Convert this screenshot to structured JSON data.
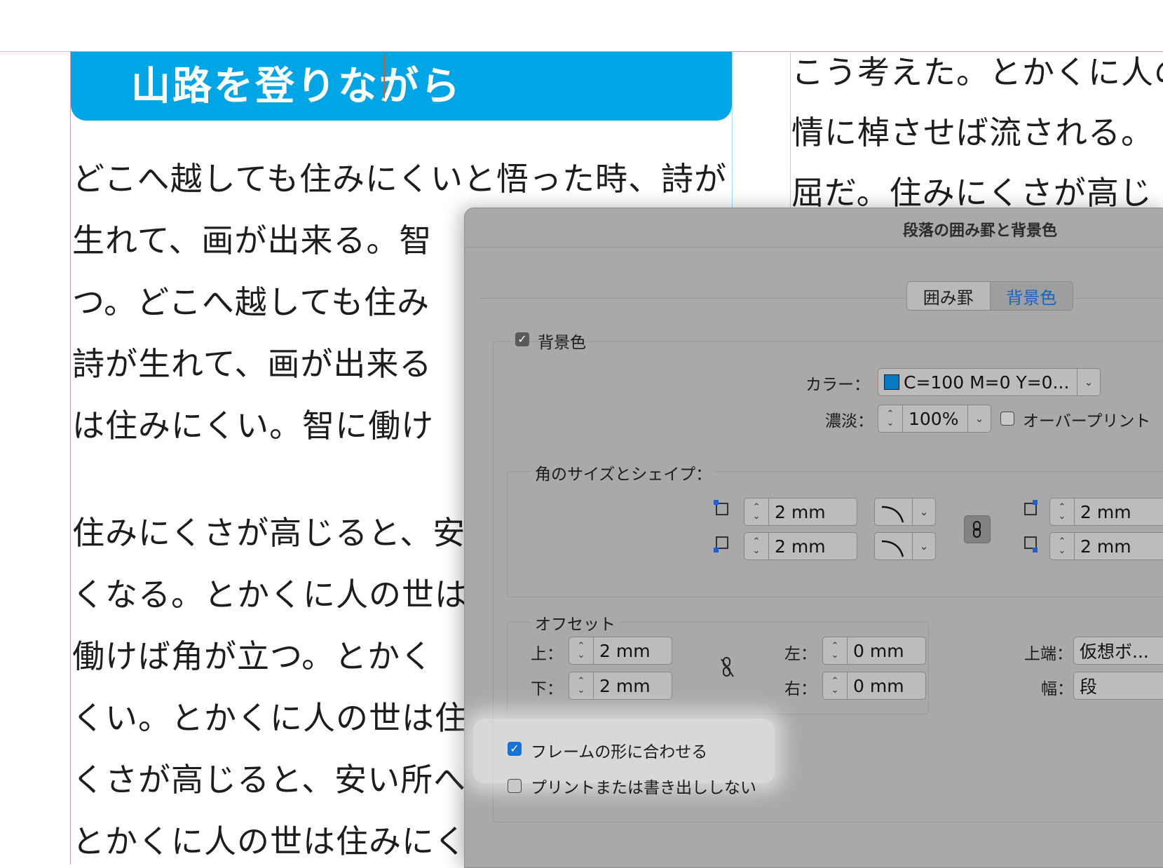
{
  "document": {
    "heading": "山路を登りながら",
    "col1_lines": [
      "どこへ越しても住みにくいと悟った時、詩が",
      "生れて、画が出来る。智",
      "つ。どこへ越しても住み",
      "詩が生れて、画が出来る",
      "は住みにくい。智に働け",
      "住みにくさが高じると、安",
      "くなる。とかくに人の世は",
      "働けば角が立つ。とかく",
      "くい。とかくに人の世は住",
      "くさが高じると、安い所へ",
      "とかくに人の世は住みにく"
    ],
    "col2_lines": [
      "こう考えた。とかくに人の",
      "情に棹させば流される。",
      "屈だ。住みにくさが高じ"
    ]
  },
  "dialog": {
    "title": "段落の囲み罫と背景色",
    "tabs": [
      {
        "label": "囲み罫"
      },
      {
        "label": "背景色"
      }
    ],
    "background_checkbox": "背景色",
    "color_label": "カラー：",
    "color_value": "C=100 M=0 Y=0...",
    "color_swatch": "#0a79c3",
    "tint_label": "濃淡：",
    "tint_value": "100%",
    "overprint_label": "オーバープリント",
    "corner_section": "角のサイズとシェイプ：",
    "corner_top_left": "2 mm",
    "corner_bottom_left": "2 mm",
    "corner_top_right": "2 mm",
    "corner_bottom_right": "2 mm",
    "offset_section": "オフセット",
    "top_label": "上：",
    "top_value": "2 mm",
    "bottom_label": "下：",
    "bottom_value": "2 mm",
    "left_label": "左：",
    "left_value": "0 mm",
    "right_label": "右：",
    "right_value": "0 mm",
    "top_edge_label": "上端：",
    "top_edge_value": "仮想ボ...",
    "width_label": "幅：",
    "width_value": "段",
    "fit_frame_label": "フレームの形に合わせる",
    "no_print_label": "プリントまたは書き出ししない"
  }
}
